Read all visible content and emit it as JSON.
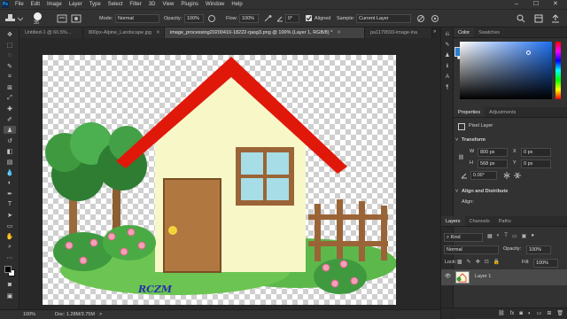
{
  "app": {
    "logo": "Ps"
  },
  "menu": [
    "File",
    "Edit",
    "Image",
    "Layer",
    "Type",
    "Select",
    "Filter",
    "3D",
    "View",
    "Plugins",
    "Window",
    "Help"
  ],
  "window_controls": {
    "minimize": "–",
    "maximize": "☐",
    "close": "✕"
  },
  "options_bar": {
    "brush_size": "35",
    "mode_label": "Mode:",
    "mode_value": "Normal",
    "opacity_label": "Opacity:",
    "opacity_value": "100%",
    "flow_label": "Flow:",
    "flow_value": "100%",
    "angle_value": "0°",
    "aligned_label": "Aligned",
    "aligned_checked": true,
    "sample_label": "Sample:",
    "sample_value": "Current Layer"
  },
  "tabs": [
    {
      "label": "Untitled-1 @ 60.5%...",
      "active": false
    },
    {
      "label": "800px-Alpine_Landscape.jpg",
      "active": false
    },
    {
      "label": "image_processing20200410-18222-rjasg3.png @ 100% (Layer 1, RGB/8) *",
      "active": true
    },
    {
      "label": "pa1179593-image-ina",
      "active": false
    }
  ],
  "tools": [
    "move-icon",
    "marquee-icon",
    "lasso-icon",
    "quick-select-icon",
    "crop-icon",
    "frame-icon",
    "eyedropper-icon",
    "healing-icon",
    "brush-icon",
    "clone-stamp-icon",
    "history-brush-icon",
    "eraser-icon",
    "gradient-icon",
    "blur-icon",
    "dodge-icon",
    "pen-icon",
    "type-icon",
    "path-select-icon",
    "rectangle-icon",
    "hand-icon",
    "zoom-icon",
    "more-tools-icon",
    "foreground-background-icon",
    "quick-mask-icon",
    "screen-mode-icon"
  ],
  "status": {
    "zoom": "100%",
    "doc": "Doc: 1.28M/3.75M",
    "arrow": ">"
  },
  "panels": {
    "color": {
      "tabs": [
        "Color",
        "Swatches"
      ],
      "fg": "#2a7fd4",
      "bg": "#ffffff"
    },
    "properties": {
      "tabs": [
        "Properties",
        "Adjustments"
      ],
      "layer_type": "Pixel Layer",
      "transform_title": "Transform",
      "w_label": "W",
      "w_value": "800 px",
      "h_label": "H",
      "h_value": "568 px",
      "x_label": "X",
      "x_value": "0 px",
      "y_label": "Y",
      "y_value": "0 px",
      "angle_value": "0.00°",
      "align_title": "Align and Distribute",
      "align_sub": "Align:"
    },
    "layers": {
      "tabs": [
        "Layers",
        "Channels",
        "Paths"
      ],
      "kind_label": "Kind",
      "blend_mode": "Normal",
      "opacity_label": "Opacity:",
      "opacity_value": "100%",
      "lock_label": "Lock:",
      "fill_label": "Fill:",
      "fill_value": "100%",
      "layer_name": "Layer 1",
      "footer_icons": [
        "link-icon",
        "fx-icon",
        "mask-icon",
        "adjustment-icon",
        "folder-icon",
        "new-layer-icon",
        "trash-icon"
      ]
    }
  },
  "artwork": {
    "watermark": "RCZM"
  }
}
